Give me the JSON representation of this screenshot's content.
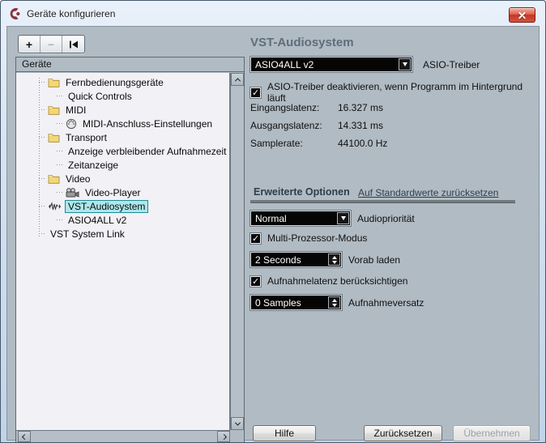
{
  "window": {
    "title": "Geräte konfigurieren"
  },
  "toolbar": {
    "add_label": "+",
    "remove_label": "−",
    "reset_icon": "skip-to-start-icon"
  },
  "tree": {
    "header": "Geräte",
    "items": [
      {
        "label": "Fernbedienungsgeräte",
        "icon": "folder",
        "level": 1,
        "selected": false
      },
      {
        "label": "Quick Controls",
        "icon": null,
        "level": 2,
        "selected": false
      },
      {
        "label": "MIDI",
        "icon": "folder",
        "level": 1,
        "selected": false
      },
      {
        "label": "MIDI-Anschluss-Einstellungen",
        "icon": "midi-port",
        "level": 2,
        "selected": false
      },
      {
        "label": "Transport",
        "icon": "folder",
        "level": 1,
        "selected": false
      },
      {
        "label": "Anzeige verbleibender Aufnahmezeit",
        "icon": null,
        "level": 2,
        "selected": false
      },
      {
        "label": "Zeitanzeige",
        "icon": null,
        "level": 2,
        "selected": false
      },
      {
        "label": "Video",
        "icon": "folder",
        "level": 1,
        "selected": false
      },
      {
        "label": "Video-Player",
        "icon": "video-camera",
        "level": 2,
        "selected": false
      },
      {
        "label": "VST-Audiosystem",
        "icon": "waveform",
        "level": 1,
        "selected": true
      },
      {
        "label": "ASIO4ALL v2",
        "icon": null,
        "level": 2,
        "selected": false
      },
      {
        "label": "VST System Link",
        "icon": null,
        "level": 1,
        "selected": false
      }
    ]
  },
  "panel": {
    "title": "VST-Audiosystem",
    "asio_driver": {
      "value": "ASIO4ALL v2",
      "label": "ASIO-Treiber"
    },
    "release_checkbox": {
      "label": "ASIO-Treiber deaktivieren, wenn Programm im Hintergrund läuft",
      "checked": true
    },
    "stats": [
      {
        "label": "Eingangslatenz:",
        "value": "16.327 ms"
      },
      {
        "label": "Ausgangslatenz:",
        "value": "14.331 ms"
      },
      {
        "label": "Samplerate:",
        "value": "44100.0 Hz"
      }
    ],
    "advanced": {
      "title": "Erweiterte Optionen",
      "reset_link": "Auf Standardwerte zurücksetzen"
    },
    "audio_priority": {
      "value": "Normal",
      "label": "Audiopriorität"
    },
    "multi_processor": {
      "label": "Multi-Prozessor-Modus",
      "checked": true
    },
    "preload": {
      "value": "2 Seconds",
      "label": "Vorab laden"
    },
    "record_latency": {
      "label": "Aufnahmelatenz berücksichtigen",
      "checked": true
    },
    "record_offset": {
      "value": "0 Samples",
      "label": "Aufnahmeversatz"
    }
  },
  "footer": {
    "help": "Hilfe",
    "reset": "Zurücksetzen",
    "apply": "Übernehmen",
    "apply_enabled": false
  },
  "colors": {
    "selection_bg": "#aee7ec",
    "selection_border": "#1f8c96",
    "heading": "#5e6e7c",
    "advanced_heading": "#2f3e4c",
    "link": "#2f3e4c",
    "combo_text": "#ffffff",
    "close_button": "#c23727"
  }
}
